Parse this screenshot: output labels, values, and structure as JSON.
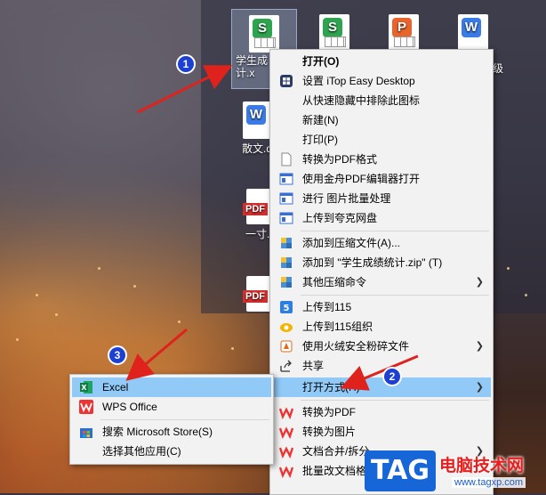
{
  "desktop": {
    "icons": [
      {
        "label": "学生成\n计.x",
        "type": "wps-sheet",
        "color": "#2ea44f",
        "selected": true
      },
      {
        "label": "",
        "type": "wps-sheet",
        "color": "#2ea44f"
      },
      {
        "label": "",
        "type": "wps-pdf",
        "color": "#e8642c"
      },
      {
        "label": "级",
        "type": "wps-doc",
        "color": "#3b7be6"
      },
      {
        "label": "散文.d",
        "type": "wps-doc",
        "color": "#3b7be6"
      },
      {
        "label": "一寸.",
        "type": "pdf"
      },
      {
        "label": "",
        "type": "pdf"
      }
    ]
  },
  "context_menu": {
    "items": [
      {
        "label": "打开(O)",
        "bold": true,
        "icon": "",
        "submenu": false
      },
      {
        "label": "设置 iTop Easy Desktop",
        "icon": "itop-grid-icon",
        "submenu": false
      },
      {
        "label": "从快速隐藏中排除此图标",
        "icon": "",
        "submenu": false
      },
      {
        "label": "新建(N)",
        "icon": "",
        "submenu": false
      },
      {
        "label": "打印(P)",
        "icon": "",
        "submenu": false
      },
      {
        "label": "转换为PDF格式",
        "icon": "blank-document-icon",
        "submenu": false
      },
      {
        "label": "使用金舟PDF编辑器打开",
        "icon": "app-window-icon",
        "submenu": false
      },
      {
        "label": "进行 图片批量处理",
        "icon": "app-window-icon",
        "submenu": false
      },
      {
        "label": "上传到夸克网盘",
        "icon": "app-window-icon",
        "submenu": false
      },
      {
        "label": "添加到压缩文件(A)...",
        "icon": "archive-icon",
        "submenu": false
      },
      {
        "label": "添加到 \"学生成绩统计.zip\" (T)",
        "icon": "archive-icon",
        "submenu": false
      },
      {
        "label": "其他压缩命令",
        "icon": "archive-icon",
        "submenu": true
      },
      {
        "label": "上传到115",
        "icon": "upload-115-icon",
        "submenu": false
      },
      {
        "label": "上传到115组织",
        "icon": "cloud-115-icon",
        "submenu": false
      },
      {
        "label": "使用火绒安全粉碎文件",
        "icon": "huorong-icon",
        "submenu": true
      },
      {
        "label": "共享",
        "icon": "share-icon",
        "submenu": false
      },
      {
        "label": "打开方式(H)",
        "icon": "",
        "submenu": true,
        "highlighted": true
      },
      {
        "label": "转换为PDF",
        "icon": "wps-icon",
        "submenu": false
      },
      {
        "label": "转换为图片",
        "icon": "wps-icon",
        "submenu": false
      },
      {
        "label": "文档合并/拆分",
        "icon": "wps-icon",
        "submenu": true
      },
      {
        "label": "批量改文档格",
        "icon": "wps-icon",
        "submenu": false
      }
    ]
  },
  "open_with_submenu": {
    "items": [
      {
        "label": "Excel",
        "icon": "excel-icon",
        "highlighted": true
      },
      {
        "label": "WPS Office",
        "icon": "wps-office-icon"
      },
      {
        "label": "搜索 Microsoft Store(S)",
        "icon": "store-icon"
      },
      {
        "label": "选择其他应用(C)",
        "icon": ""
      }
    ]
  },
  "annotations": {
    "step1": "1",
    "step2": "2",
    "step3": "3",
    "arrow_color": "#e0221d"
  },
  "watermark": {
    "tag": "TAG",
    "title": "电脑技术网",
    "url": "www.tagxp.com"
  },
  "colors": {
    "menu_bg": "#f2f2f2",
    "highlight": "#91c9f7",
    "badge_blue": "#1c3fd4"
  }
}
